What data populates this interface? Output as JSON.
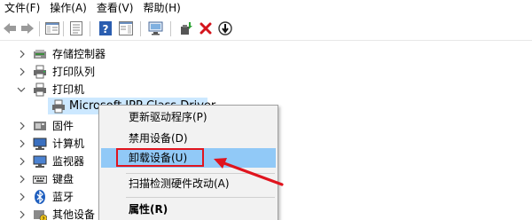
{
  "menubar": {
    "items": [
      "文件(F)",
      "操作(A)",
      "查看(V)",
      "帮助(H)"
    ]
  },
  "toolbar": {
    "buttons": [
      "back-icon",
      "forward-icon",
      "show-hide-console-tree-icon",
      "properties-icon",
      "help-icon",
      "show-action-pane-icon",
      "scan-hardware-icon",
      "update-driver-icon",
      "uninstall-icon",
      "disable-device-icon"
    ]
  },
  "tree": {
    "nodes": [
      {
        "label": "存储控制器",
        "icon": "storage-controller-icon",
        "expanded": false
      },
      {
        "label": "打印队列",
        "icon": "print-queue-icon",
        "expanded": false
      },
      {
        "label": "打印机",
        "icon": "printer-icon",
        "expanded": true
      },
      {
        "label": "Microsoft IPP Class Driver",
        "icon": "printer-device-icon",
        "child": true,
        "selected": true
      },
      {
        "label": "固件",
        "icon": "firmware-icon",
        "expanded": false
      },
      {
        "label": "计算机",
        "icon": "computer-icon",
        "expanded": false
      },
      {
        "label": "监视器",
        "icon": "monitor-icon",
        "expanded": false
      },
      {
        "label": "键盘",
        "icon": "keyboard-icon",
        "expanded": false
      },
      {
        "label": "蓝牙",
        "icon": "bluetooth-icon",
        "expanded": false
      },
      {
        "label": "其他设备",
        "icon": "other-devices-icon",
        "expanded": false
      }
    ]
  },
  "context_menu": {
    "items": [
      {
        "label": "更新驱动程序(P)",
        "bold": false
      },
      {
        "label": "禁用设备(D)",
        "bold": false
      },
      {
        "label": "卸载设备(U)",
        "bold": false,
        "highlighted": true
      },
      {
        "label": "扫描检测硬件改动(A)",
        "bold": false
      },
      {
        "label": "属性(R)",
        "bold": true
      }
    ]
  },
  "colors": {
    "highlight": "#91c9f7",
    "selection": "#cce8ff",
    "annotation_red": "#e0141e"
  }
}
